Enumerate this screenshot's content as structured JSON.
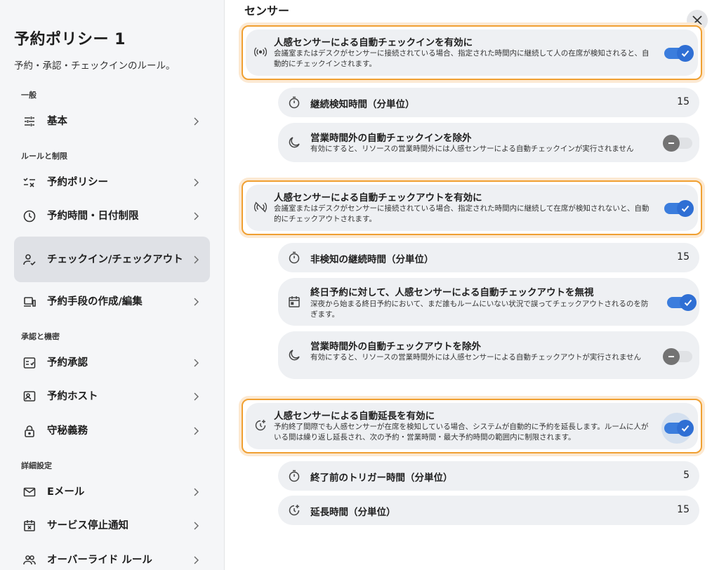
{
  "sidebar": {
    "title": "予約ポリシー 1",
    "subtitle": "予約・承認・チェックインのルール。",
    "sections": {
      "general": "一般",
      "rules": "ルールと制限",
      "approval": "承認と機密",
      "advanced": "詳細設定"
    },
    "items": [
      {
        "label": "基本",
        "icon": "sliders-icon"
      },
      {
        "label": "予約ポリシー",
        "icon": "checklist-icon"
      },
      {
        "label": "予約時間・日付制限",
        "icon": "clock-icon"
      },
      {
        "label": "チェックイン/チェックアウト",
        "icon": "person-check-icon",
        "active": true
      },
      {
        "label": "予約手段の作成/編集",
        "icon": "devices-icon"
      },
      {
        "label": "予約承認",
        "icon": "approval-icon"
      },
      {
        "label": "予約ホスト",
        "icon": "host-icon"
      },
      {
        "label": "守秘義務",
        "icon": "lock-icon"
      },
      {
        "label": "Eメール",
        "icon": "mail-icon"
      },
      {
        "label": "サービス停止通知",
        "icon": "calendar-x-icon"
      },
      {
        "label": "オーバーライド ルール",
        "icon": "people-icon"
      }
    ]
  },
  "main": {
    "section_title": "センサー",
    "features": [
      {
        "title": "人感センサーによる自動チェックインを有効に",
        "desc": "会議室またはデスクがセンサーに接続されている場合、指定された時間内に継続して人の在席が検知されると、自動的にチェックインされます。",
        "enabled": true,
        "icon": "sensor-icon"
      },
      {
        "title": "人感センサーによる自動チェックアウトを有効に",
        "desc": "会議室またはデスクがセンサーに接続されている場合、指定された時間内に継続して在席が検知されないと、自動的にチェックアウトされます。",
        "enabled": true,
        "icon": "sensor-off-icon"
      },
      {
        "title": "人感センサーによる自動延長を有効に",
        "desc": "予約終了間際でも人感センサーが在席を検知している場合、システムが自動的に予約を延長します。ルームに人がいる間は繰り返し延長され、次の予約・営業時間・最大予約時間の範囲内に制限されます。",
        "enabled": true,
        "icon": "extend-icon"
      }
    ],
    "rows": {
      "checkin_duration": {
        "label": "継続検知時間（分単位）",
        "value": "15"
      },
      "checkin_exclude": {
        "label": "営業時間外の自動チェックインを除外",
        "desc": "有効にすると、リソースの営業時間外には人感センサーによる自動チェックインが実行されません",
        "enabled": false
      },
      "checkout_duration": {
        "label": "非検知の継続時間（分単位）",
        "value": "15"
      },
      "allday_ignore": {
        "label": "終日予約に対して、人感センサーによる自動チェックアウトを無視",
        "desc": "深夜から始まる終日予約において、まだ誰もルームにいない状況で誤ってチェックアウトされるのを防ぎます。",
        "enabled": true
      },
      "checkout_exclude": {
        "label": "営業時間外の自動チェックアウトを除外",
        "desc": "有効にすると、リソースの営業時間外には人感センサーによる自動チェックアウトが実行されません",
        "enabled": false
      },
      "trigger_time": {
        "label": "終了前のトリガー時間（分単位）",
        "value": "5"
      },
      "extend_time": {
        "label": "延長時間（分単位）",
        "value": "15"
      }
    }
  },
  "colors": {
    "accent": "#2f6fd4",
    "highlight": "#f0a032",
    "row_bg": "#eef0f3"
  }
}
